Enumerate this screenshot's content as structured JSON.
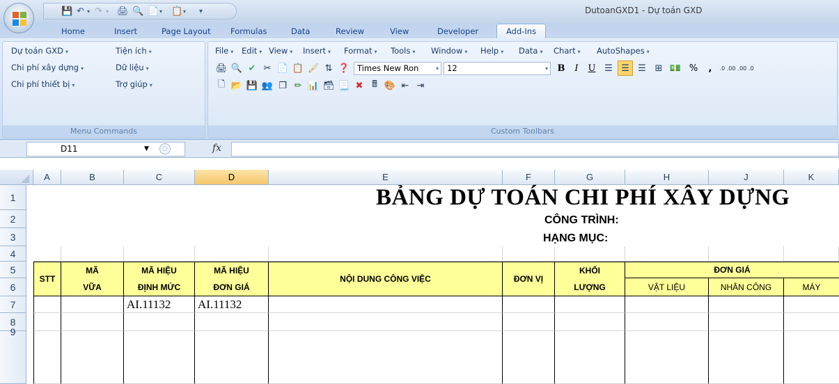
{
  "window": {
    "title": "DutoanGXD1 - Dự toán GXD"
  },
  "ribbon_tabs": [
    "Home",
    "Insert",
    "Page Layout",
    "Formulas",
    "Data",
    "Review",
    "View",
    "Developer",
    "Add-Ins"
  ],
  "active_tab": "Add-Ins",
  "menu_commands": {
    "items": [
      "Dự toán GXD",
      "Tiện ích",
      "Chi phí xây dựng",
      "Dữ liệu",
      "Chi phí thiết bị",
      "Trợ giúp"
    ],
    "group_label": "Menu Commands"
  },
  "custom_toolbars": {
    "menu": [
      "File",
      "Edit",
      "View",
      "Insert",
      "Format",
      "Tools",
      "Window",
      "Help",
      "Data",
      "Chart",
      "AutoShapes"
    ],
    "font_name": "Times New Ron",
    "font_size": "12",
    "percent": "%",
    "comma": ",",
    "inc_decimal": ".0 .00",
    "dec_decimal": ".00 .0",
    "group_label": "Custom Toolbars"
  },
  "formula_bar": {
    "name_box": "D11",
    "fx_label": "fx",
    "formula": ""
  },
  "columns": [
    "A",
    "B",
    "C",
    "D",
    "E",
    "F",
    "G",
    "H",
    "J",
    "K"
  ],
  "selected_column": "D",
  "rows": [
    "1",
    "2",
    "3",
    "4",
    "5",
    "6",
    "7",
    "8",
    "9"
  ],
  "sheet": {
    "title": "BẢNG DỰ TOÁN CHI PHÍ XÂY DỰNG",
    "cong_trinh": "CÔNG TRÌNH:",
    "hang_muc": "HẠNG MỤC:",
    "headers": {
      "stt": "STT",
      "ma_vua": "MÃ VỮA",
      "ma_hieu_dinh_muc_1": "MÃ HIỆU",
      "ma_hieu_dinh_muc_2": "ĐỊNH MỨC",
      "ma_hieu_don_gia_1": "MÃ HIỆU",
      "ma_hieu_don_gia_2": "ĐƠN GIÁ",
      "noi_dung": "NỘI DUNG CÔNG VIỆC",
      "don_vi": "ĐƠN VỊ",
      "khoi_luong_1": "KHỐI",
      "khoi_luong_2": "LƯỢNG",
      "don_gia": "ĐƠN GIÁ",
      "vat_lieu": "VẬT LIỆU",
      "nhan_cong": "NHÂN CÔNG",
      "may": "MÁY"
    },
    "row7": {
      "c": "AI.11132",
      "d": "AI.11132"
    }
  }
}
